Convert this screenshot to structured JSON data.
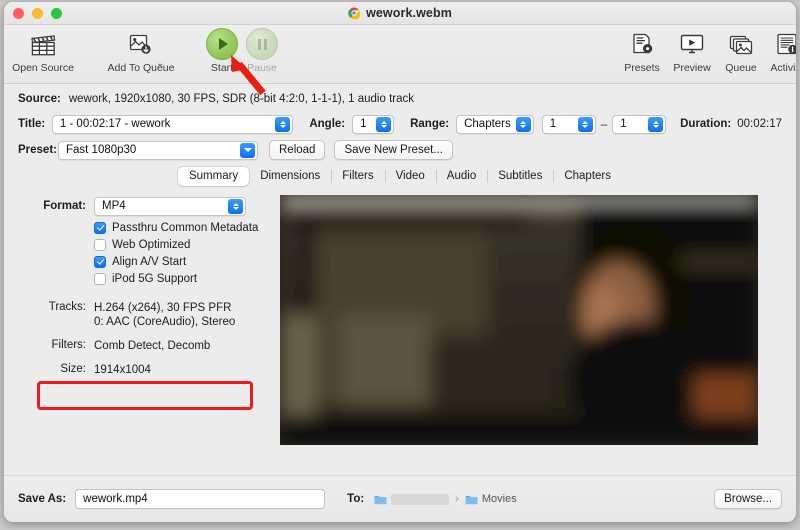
{
  "window": {
    "title": "wework.webm",
    "app_icon": "chrome-icon",
    "traffic_lights": [
      "close",
      "minimize",
      "zoom"
    ]
  },
  "toolbar": {
    "items": [
      {
        "label": "Open Source",
        "icon": "clapperboard-icon",
        "enabled": true
      },
      {
        "label": "Add To Queue",
        "icon": "add-to-queue-icon",
        "enabled": true,
        "has_menu": true
      },
      {
        "label": "Start",
        "icon": "play-circle-icon",
        "enabled": true
      },
      {
        "label": "Pause",
        "icon": "pause-circle-icon",
        "enabled": false
      },
      {
        "label": "Presets",
        "icon": "presets-icon",
        "enabled": true
      },
      {
        "label": "Preview",
        "icon": "preview-monitor-icon",
        "enabled": true
      },
      {
        "label": "Queue",
        "icon": "queue-stack-icon",
        "enabled": true
      },
      {
        "label": "Activity",
        "icon": "activity-log-icon",
        "enabled": true
      }
    ]
  },
  "source": {
    "label": "Source:",
    "value": "wework, 1920x1080, 30 FPS, SDR (8-bit 4:2:0, 1-1-1), 1 audio track"
  },
  "title_row": {
    "title_label": "Title:",
    "title_value": "1 - 00:02:17 - wework",
    "angle_label": "Angle:",
    "angle_value": "1",
    "range_label": "Range:",
    "range_type": "Chapters",
    "range_start": "1",
    "range_dash": "–",
    "range_end": "1",
    "duration_label": "Duration:",
    "duration_value": "00:02:17"
  },
  "preset_row": {
    "preset_label": "Preset:",
    "preset_value": "Fast 1080p30",
    "reload_label": "Reload",
    "save_preset_label": "Save New Preset..."
  },
  "tabs": [
    {
      "label": "Summary",
      "active": true
    },
    {
      "label": "Dimensions",
      "active": false
    },
    {
      "label": "Filters",
      "active": false
    },
    {
      "label": "Video",
      "active": false
    },
    {
      "label": "Audio",
      "active": false
    },
    {
      "label": "Subtitles",
      "active": false
    },
    {
      "label": "Chapters",
      "active": false
    }
  ],
  "summary": {
    "format_label": "Format:",
    "format_value": "MP4",
    "checkboxes": [
      {
        "label": "Passthru Common Metadata",
        "checked": true
      },
      {
        "label": "Web Optimized",
        "checked": false
      },
      {
        "label": "Align A/V Start",
        "checked": true
      },
      {
        "label": "iPod 5G Support",
        "checked": false
      }
    ],
    "tracks_label": "Tracks:",
    "tracks_line1": "H.264 (x264), 30 FPS PFR",
    "tracks_line2": "0: AAC (CoreAudio), Stereo",
    "filters_label": "Filters:",
    "filters_value": "Comb Detect, Decomb",
    "size_label": "Size:",
    "size_value": "1914x1004"
  },
  "bottom": {
    "save_as_label": "Save As:",
    "save_as_value": "wework.mp4",
    "to_label": "To:",
    "path_first_redacted": true,
    "path_separator": "›",
    "path_last": "Movies",
    "browse_label": "Browse..."
  },
  "annotations": {
    "highlight_target": "format-popup",
    "highlight_color": "#ee1b1b",
    "arrow_target": "start-button",
    "arrow_color": "#e81f12"
  }
}
